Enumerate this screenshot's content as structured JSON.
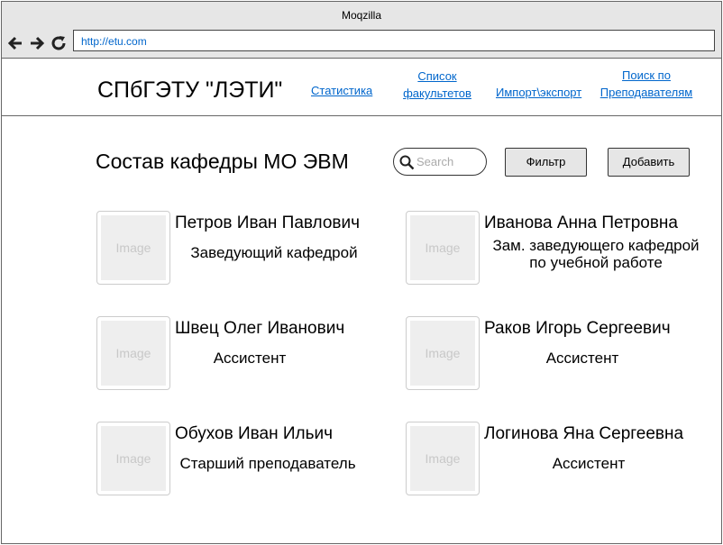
{
  "window": {
    "title": "Moqzilla"
  },
  "navbar": {
    "url": "http://etu.com",
    "icons": [
      "back-arrow-icon",
      "forward-arrow-icon",
      "reload-icon"
    ]
  },
  "header": {
    "brand": "СПбГЭТУ \"ЛЭТИ\"",
    "links": [
      {
        "line1": "Статистика"
      },
      {
        "line1": "Список ",
        "line2": "факультетов"
      },
      {
        "line1": "Импорт\\экспорт"
      },
      {
        "line1": "Поиск по ",
        "line2": "Преподавателям"
      }
    ],
    "link_color": "#0066cc"
  },
  "toolbar": {
    "title": "Состав кафедры МО ЭВМ",
    "search_placeholder": "Search",
    "filter_label": "Фильтр",
    "add_label": "Добавить"
  },
  "staff": [
    {
      "image_label": "Image",
      "name": "Петров Иван Павлович",
      "role": "Заведующий кафедрой"
    },
    {
      "image_label": "Image",
      "name": "Иванова Анна Петровна",
      "role_line1": "Зам. заведующего кафедрой",
      "role_line2": "по учебной работе"
    },
    {
      "image_label": "Image",
      "name": "Швец Олег Иванович",
      "role": "Ассистент"
    },
    {
      "image_label": "Image",
      "name": "Раков Игорь Сергеевич",
      "role": "Ассистент"
    },
    {
      "image_label": "Image",
      "name": "Обухов Иван Ильич",
      "role": "Старший преподаватель"
    },
    {
      "image_label": "Image",
      "name": "Логинова Яна Сергеевна",
      "role": "Ассистент"
    }
  ]
}
